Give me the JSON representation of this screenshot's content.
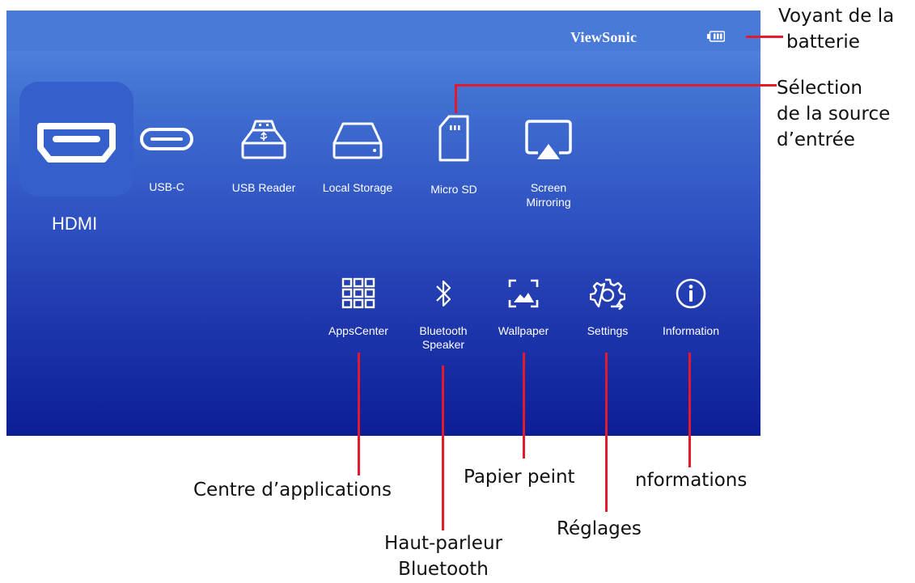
{
  "screen": {
    "brand": "ViewSonic",
    "battery_icon": "battery-icon",
    "sources": [
      {
        "label": "HDMI",
        "icon": "hdmi-icon",
        "selected": true
      },
      {
        "label": "USB-C",
        "icon": "usb-c-icon"
      },
      {
        "label": "USB Reader",
        "icon": "usb-reader-icon"
      },
      {
        "label": "Local Storage",
        "icon": "local-storage-icon"
      },
      {
        "label": "Micro SD",
        "icon": "micro-sd-icon"
      },
      {
        "label_line1": "Screen",
        "label_line2": "Mirroring",
        "icon": "screen-mirroring-icon"
      }
    ],
    "apps": [
      {
        "label": "AppsCenter",
        "icon": "apps-grid-icon"
      },
      {
        "label_line1": "Bluetooth",
        "label_line2": "Speaker",
        "icon": "bluetooth-icon"
      },
      {
        "label": "Wallpaper",
        "icon": "wallpaper-icon"
      },
      {
        "label": "Settings",
        "icon": "gear-icon"
      },
      {
        "label": "Information",
        "icon": "info-icon"
      }
    ]
  },
  "annotations": {
    "battery_line1": "Voyant de la",
    "battery_line2": "batterie",
    "source_line1": "Sélection",
    "source_line2": "de la source",
    "source_line3": "d’entrée",
    "apps_center": "Centre d’applications",
    "bluetooth_line1": "Haut-parleur",
    "bluetooth_line2": "Bluetooth",
    "wallpaper": "Papier peint",
    "settings": "Réglages",
    "information": "nformations"
  },
  "colors": {
    "callout_line": "#e11b2c",
    "hdmi_tile": "#3560cc",
    "screen_top": "#5b8de6",
    "screen_bottom": "#0c1e96"
  }
}
